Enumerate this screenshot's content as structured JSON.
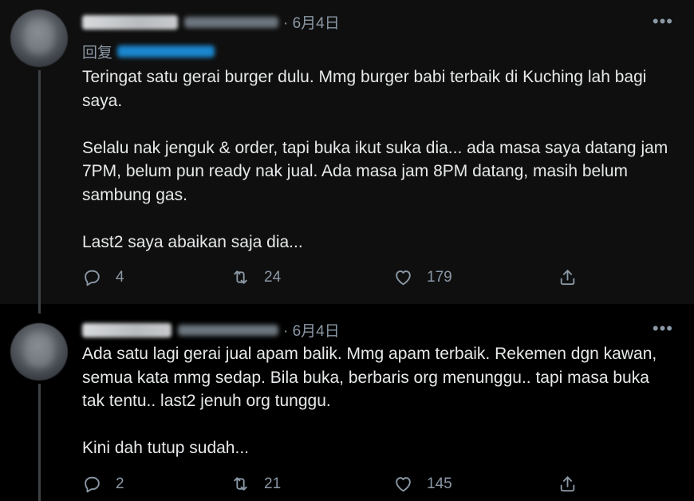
{
  "tweets": [
    {
      "date": "· 6月4日",
      "reply_prefix": "回复",
      "paragraphs": [
        "Teringat satu gerai burger dulu. Mmg burger babi terbaik di Kuching lah bagi saya.",
        "Selalu nak jenguk & order, tapi buka ikut suka dia... ada masa saya datang jam 7PM, belum pun ready nak jual. Ada masa jam 8PM datang, masih belum sambung gas.",
        "Last2 saya abaikan saja dia..."
      ],
      "replies": "4",
      "retweets": "24",
      "likes": "179"
    },
    {
      "date": "· 6月4日",
      "paragraphs": [
        "Ada satu lagi gerai jual apam balik. Mmg apam terbaik. Rekemen dgn kawan, semua kata mmg sedap. Bila buka, berbaris org menunggu.. tapi masa buka tak tentu.. last2 jenuh org tunggu.",
        "Kini dah tutup sudah..."
      ],
      "replies": "2",
      "retweets": "21",
      "likes": "145"
    }
  ],
  "more_label": "•••",
  "icons": {
    "reply": "reply-bubble-icon",
    "retweet": "retweet-icon",
    "like": "heart-icon",
    "share": "share-icon",
    "more": "more-dots-icon"
  },
  "colors": {
    "background": "#000000",
    "text": "#e7e9ea",
    "muted": "#8b98a5",
    "accent": "#1d9bf0",
    "thread_line": "#3e4144"
  }
}
